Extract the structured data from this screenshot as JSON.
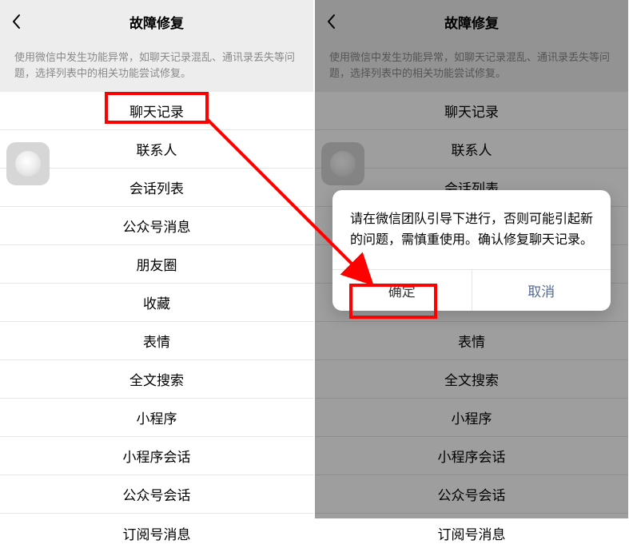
{
  "header": {
    "title": "故障修复"
  },
  "description": "使用微信中发生功能异常，如聊天记录混乱、通讯录丢失等问题，选择列表中的相关功能尝试修复。",
  "items": [
    "聊天记录",
    "联系人",
    "会话列表",
    "公众号消息",
    "朋友圈",
    "收藏",
    "表情",
    "全文搜索",
    "小程序",
    "小程序会话",
    "公众号会话",
    "订阅号消息"
  ],
  "dialog": {
    "message": "请在微信团队引导下进行，否则可能引起新的问题，需慎重使用。确认修复聊天记录。",
    "confirm": "确定",
    "cancel": "取消"
  }
}
